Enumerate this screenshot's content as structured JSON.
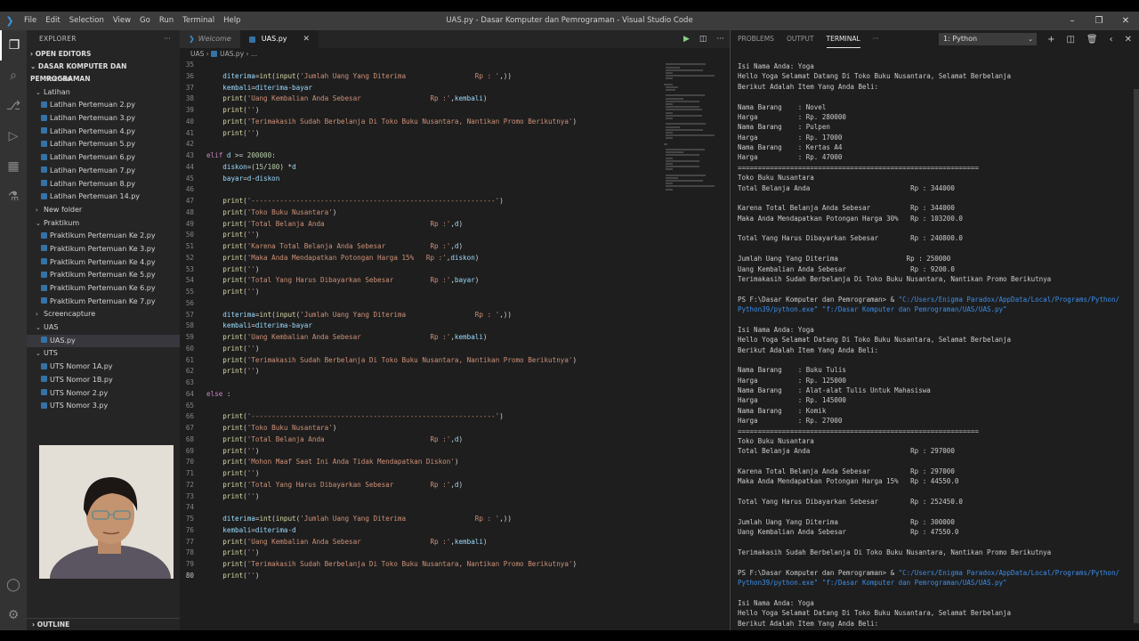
{
  "window": {
    "title": "UAS.py - Dasar Komputer dan Pemrograman - Visual Studio Code",
    "menu": [
      "File",
      "Edit",
      "Selection",
      "View",
      "Go",
      "Run",
      "Terminal",
      "Help"
    ]
  },
  "sidebar": {
    "header": "EXPLORER",
    "open_editors": "OPEN EDITORS",
    "project": "DASAR KOMPUTER DAN PEMROGRAMAN",
    "outline": "OUTLINE",
    "tree": [
      {
        "label": ".vscode",
        "type": "folder",
        "open": false,
        "indent": 1
      },
      {
        "label": "Latihan",
        "type": "folder",
        "open": true,
        "indent": 1
      },
      {
        "label": "Latihan Pertemuan 2.py",
        "type": "file",
        "indent": 2
      },
      {
        "label": "Latihan Pertemuan 3.py",
        "type": "file",
        "indent": 2
      },
      {
        "label": "Latihan Pertemuan 4.py",
        "type": "file",
        "indent": 2
      },
      {
        "label": "Latihan Pertemuan 5.py",
        "type": "file",
        "indent": 2
      },
      {
        "label": "Latihan Pertemuan 6.py",
        "type": "file",
        "indent": 2
      },
      {
        "label": "Latihan Pertemuan 7.py",
        "type": "file",
        "indent": 2
      },
      {
        "label": "Latihan Pertemuan 8.py",
        "type": "file",
        "indent": 2
      },
      {
        "label": "Latihan Pertemuan 14.py",
        "type": "file",
        "indent": 2
      },
      {
        "label": "New folder",
        "type": "folder",
        "open": false,
        "indent": 1
      },
      {
        "label": "Praktikum",
        "type": "folder",
        "open": true,
        "indent": 1
      },
      {
        "label": "Praktikum Pertemuan Ke 2.py",
        "type": "file",
        "indent": 2
      },
      {
        "label": "Praktikum Pertemuan Ke 3.py",
        "type": "file",
        "indent": 2
      },
      {
        "label": "Praktikum Pertemuan Ke 4.py",
        "type": "file",
        "indent": 2
      },
      {
        "label": "Praktikum Pertemuan Ke 5.py",
        "type": "file",
        "indent": 2
      },
      {
        "label": "Praktikum Pertemuan Ke 6.py",
        "type": "file",
        "indent": 2
      },
      {
        "label": "Praktikum Pertemuan Ke 7.py",
        "type": "file",
        "indent": 2
      },
      {
        "label": "Screencapture",
        "type": "folder",
        "open": false,
        "indent": 1
      },
      {
        "label": "UAS",
        "type": "folder",
        "open": true,
        "indent": 1
      },
      {
        "label": "UAS.py",
        "type": "file",
        "indent": 2,
        "selected": true
      },
      {
        "label": "UTS",
        "type": "folder",
        "open": true,
        "indent": 1
      },
      {
        "label": "UTS Nomor 1A.py",
        "type": "file",
        "indent": 2
      },
      {
        "label": "UTS Nomor 1B.py",
        "type": "file",
        "indent": 2
      },
      {
        "label": "UTS Nomor 2.py",
        "type": "file",
        "indent": 2
      },
      {
        "label": "UTS Nomor 3.py",
        "type": "file",
        "indent": 2
      }
    ]
  },
  "editor": {
    "tabs": [
      {
        "label": "Welcome",
        "active": false,
        "icon": "vscode-logo-icon"
      },
      {
        "label": "UAS.py",
        "active": true,
        "icon": "python-file-icon"
      }
    ],
    "breadcrumb": [
      "UAS",
      "UAS.py",
      "..."
    ],
    "current_line": 80,
    "lines": [
      {
        "n": 35,
        "t": ""
      },
      {
        "n": 36,
        "t": "    diterima=int(input('Jumlah Uang Yang Diterima                 Rp : ',))"
      },
      {
        "n": 37,
        "t": "    kembali=diterima-bayar"
      },
      {
        "n": 38,
        "t": "    print('Uang Kembalian Anda Sebesar                 Rp :',kembali)"
      },
      {
        "n": 39,
        "t": "    print('')"
      },
      {
        "n": 40,
        "t": "    print('Terimakasih Sudah Berbelanja Di Toko Buku Nusantara, Nantikan Promo Berikutnya')"
      },
      {
        "n": 41,
        "t": "    print('')"
      },
      {
        "n": 42,
        "t": ""
      },
      {
        "n": 43,
        "t": "elif d >= 200000:"
      },
      {
        "n": 44,
        "t": "    diskon=(15/100) *d"
      },
      {
        "n": 45,
        "t": "    bayar=d-diskon"
      },
      {
        "n": 46,
        "t": ""
      },
      {
        "n": 47,
        "t": "    print('------------------------------------------------------------')"
      },
      {
        "n": 48,
        "t": "    print('Toko Buku Nusantara')"
      },
      {
        "n": 49,
        "t": "    print('Total Belanja Anda                          Rp :',d)"
      },
      {
        "n": 50,
        "t": "    print('')"
      },
      {
        "n": 51,
        "t": "    print('Karena Total Belanja Anda Sebesar           Rp :',d)"
      },
      {
        "n": 52,
        "t": "    print('Maka Anda Mendapatkan Potongan Harga 15%   Rp :',diskon)"
      },
      {
        "n": 53,
        "t": "    print('')"
      },
      {
        "n": 54,
        "t": "    print('Total Yang Harus Dibayarkan Sebesar         Rp :',bayar)"
      },
      {
        "n": 55,
        "t": "    print('')"
      },
      {
        "n": 56,
        "t": ""
      },
      {
        "n": 57,
        "t": "    diterima=int(input('Jumlah Uang Yang Diterima                 Rp : ',))"
      },
      {
        "n": 58,
        "t": "    kembali=diterima-bayar"
      },
      {
        "n": 59,
        "t": "    print('Uang Kembalian Anda Sebesar                 Rp :',kembali)"
      },
      {
        "n": 60,
        "t": "    print('')"
      },
      {
        "n": 61,
        "t": "    print('Terimakasih Sudah Berbelanja Di Toko Buku Nusantara, Nantikan Promo Berikutnya')"
      },
      {
        "n": 62,
        "t": "    print('')"
      },
      {
        "n": 63,
        "t": ""
      },
      {
        "n": 64,
        "t": "else :"
      },
      {
        "n": 65,
        "t": ""
      },
      {
        "n": 66,
        "t": "    print('------------------------------------------------------------')"
      },
      {
        "n": 67,
        "t": "    print('Toko Buku Nusantara')"
      },
      {
        "n": 68,
        "t": "    print('Total Belanja Anda                          Rp :',d)"
      },
      {
        "n": 69,
        "t": "    print('')"
      },
      {
        "n": 70,
        "t": "    print('Mohon Maaf Saat Ini Anda Tidak Mendapatkan Diskon')"
      },
      {
        "n": 71,
        "t": "    print('')"
      },
      {
        "n": 72,
        "t": "    print('Total Yang Harus Dibayarkan Sebesar         Rp :',d)"
      },
      {
        "n": 73,
        "t": "    print('')"
      },
      {
        "n": 74,
        "t": ""
      },
      {
        "n": 75,
        "t": "    diterima=int(input('Jumlah Uang Yang Diterima                 Rp : ',))"
      },
      {
        "n": 76,
        "t": "    kembali=diterima-d"
      },
      {
        "n": 77,
        "t": "    print('Uang Kembalian Anda Sebesar                 Rp :',kembali)"
      },
      {
        "n": 78,
        "t": "    print('')"
      },
      {
        "n": 79,
        "t": "    print('Terimakasih Sudah Berbelanja Di Toko Buku Nusantara, Nantikan Promo Berikutnya')"
      },
      {
        "n": 80,
        "t": "    print('')"
      }
    ]
  },
  "panel": {
    "tabs": [
      "PROBLEMS",
      "OUTPUT",
      "TERMINAL",
      "···"
    ],
    "active_tab": "TERMINAL",
    "terminal_select": "1: Python",
    "lines": [
      "Isi Nama Anda: Yoga",
      "Hello Yoga Selamat Datang Di Toko Buku Nusantara, Selamat Berbelanja",
      "Berikut Adalah Item Yang Anda Beli:",
      "",
      "Nama Barang    : Novel",
      "Harga          : Rp. 280000",
      "Nama Barang    : Pulpen",
      "Harga          : Rp. 17000",
      "Nama Barang    : Kertas A4",
      "Harga          : Rp. 47000",
      "============================================================",
      "Toko Buku Nusantara",
      "Total Belanja Anda                         Rp : 344000",
      "",
      "Karena Total Belanja Anda Sebesar          Rp : 344000",
      "Maka Anda Mendapatkan Potongan Harga 30%   Rp : 103200.0",
      "",
      "Total Yang Harus Dibayarkan Sebesar        Rp : 240800.0",
      "",
      "Jumlah Uang Yang Diterima                 Rp : 250000",
      "Uang Kembalian Anda Sebesar                Rp : 9200.0",
      "Terimakasih Sudah Berbelanja Di Toko Buku Nusantara, Nantikan Promo Berikutnya",
      "",
      "PS F:\\Dasar Komputer dan Pemrograman> & \"C:/Users/Enigma Paradox/AppData/Local/Programs/Python/",
      "Python39/python.exe\" \"f:/Dasar Komputer dan Pemrograman/UAS/UAS.py\"",
      "",
      "Isi Nama Anda: Yoga",
      "Hello Yoga Selamat Datang Di Toko Buku Nusantara, Selamat Berbelanja",
      "Berikut Adalah Item Yang Anda Beli:",
      "",
      "Nama Barang    : Buku Tulis",
      "Harga          : Rp. 125000",
      "Nama Barang    : Alat-alat Tulis Untuk Mahasiswa",
      "Harga          : Rp. 145000",
      "Nama Barang    : Komik",
      "Harga          : Rp. 27000",
      "============================================================",
      "Toko Buku Nusantara",
      "Total Belanja Anda                         Rp : 297000",
      "",
      "Karena Total Belanja Anda Sebesar          Rp : 297000",
      "Maka Anda Mendapatkan Potongan Harga 15%   Rp : 44550.0",
      "",
      "Total Yang Harus Dibayarkan Sebesar        Rp : 252450.0",
      "",
      "Jumlah Uang Yang Diterima                  Rp : 300000",
      "Uang Kembalian Anda Sebesar                Rp : 47550.0",
      "",
      "Terimakasih Sudah Berbelanja Di Toko Buku Nusantara, Nantikan Promo Berikutnya",
      "",
      "PS F:\\Dasar Komputer dan Pemrograman> & \"C:/Users/Enigma Paradox/AppData/Local/Programs/Python/",
      "Python39/python.exe\" \"f:/Dasar Komputer dan Pemrograman/UAS/UAS.py\"",
      "",
      "Isi Nama Anda: Yoga",
      "Hello Yoga Selamat Datang Di Toko Buku Nusantara, Selamat Berbelanja",
      "Berikut Adalah Item Yang Anda Beli:"
    ]
  },
  "colors": {
    "accent": "#007acc",
    "titlebar": "#3c3c3c",
    "editor_bg": "#1e1e1e",
    "sidebar_bg": "#252526",
    "activitybar": "#333333"
  }
}
